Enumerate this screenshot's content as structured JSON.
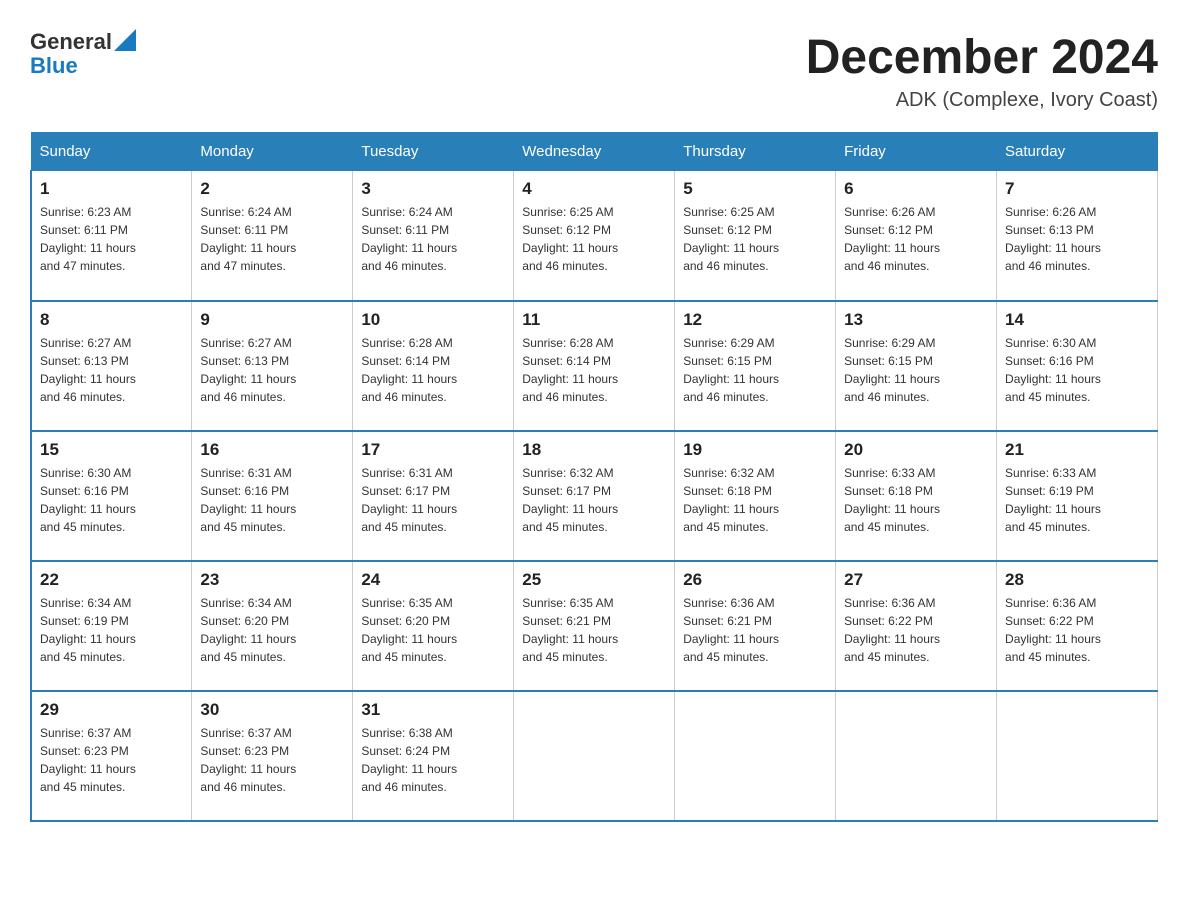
{
  "header": {
    "logo_text_general": "General",
    "logo_text_blue": "Blue",
    "month_title": "December 2024",
    "location": "ADK (Complexe, Ivory Coast)"
  },
  "days_of_week": [
    "Sunday",
    "Monday",
    "Tuesday",
    "Wednesday",
    "Thursday",
    "Friday",
    "Saturday"
  ],
  "weeks": [
    [
      {
        "day": "1",
        "sunrise": "6:23 AM",
        "sunset": "6:11 PM",
        "daylight": "11 hours and 47 minutes."
      },
      {
        "day": "2",
        "sunrise": "6:24 AM",
        "sunset": "6:11 PM",
        "daylight": "11 hours and 47 minutes."
      },
      {
        "day": "3",
        "sunrise": "6:24 AM",
        "sunset": "6:11 PM",
        "daylight": "11 hours and 46 minutes."
      },
      {
        "day": "4",
        "sunrise": "6:25 AM",
        "sunset": "6:12 PM",
        "daylight": "11 hours and 46 minutes."
      },
      {
        "day": "5",
        "sunrise": "6:25 AM",
        "sunset": "6:12 PM",
        "daylight": "11 hours and 46 minutes."
      },
      {
        "day": "6",
        "sunrise": "6:26 AM",
        "sunset": "6:12 PM",
        "daylight": "11 hours and 46 minutes."
      },
      {
        "day": "7",
        "sunrise": "6:26 AM",
        "sunset": "6:13 PM",
        "daylight": "11 hours and 46 minutes."
      }
    ],
    [
      {
        "day": "8",
        "sunrise": "6:27 AM",
        "sunset": "6:13 PM",
        "daylight": "11 hours and 46 minutes."
      },
      {
        "day": "9",
        "sunrise": "6:27 AM",
        "sunset": "6:13 PM",
        "daylight": "11 hours and 46 minutes."
      },
      {
        "day": "10",
        "sunrise": "6:28 AM",
        "sunset": "6:14 PM",
        "daylight": "11 hours and 46 minutes."
      },
      {
        "day": "11",
        "sunrise": "6:28 AM",
        "sunset": "6:14 PM",
        "daylight": "11 hours and 46 minutes."
      },
      {
        "day": "12",
        "sunrise": "6:29 AM",
        "sunset": "6:15 PM",
        "daylight": "11 hours and 46 minutes."
      },
      {
        "day": "13",
        "sunrise": "6:29 AM",
        "sunset": "6:15 PM",
        "daylight": "11 hours and 46 minutes."
      },
      {
        "day": "14",
        "sunrise": "6:30 AM",
        "sunset": "6:16 PM",
        "daylight": "11 hours and 45 minutes."
      }
    ],
    [
      {
        "day": "15",
        "sunrise": "6:30 AM",
        "sunset": "6:16 PM",
        "daylight": "11 hours and 45 minutes."
      },
      {
        "day": "16",
        "sunrise": "6:31 AM",
        "sunset": "6:16 PM",
        "daylight": "11 hours and 45 minutes."
      },
      {
        "day": "17",
        "sunrise": "6:31 AM",
        "sunset": "6:17 PM",
        "daylight": "11 hours and 45 minutes."
      },
      {
        "day": "18",
        "sunrise": "6:32 AM",
        "sunset": "6:17 PM",
        "daylight": "11 hours and 45 minutes."
      },
      {
        "day": "19",
        "sunrise": "6:32 AM",
        "sunset": "6:18 PM",
        "daylight": "11 hours and 45 minutes."
      },
      {
        "day": "20",
        "sunrise": "6:33 AM",
        "sunset": "6:18 PM",
        "daylight": "11 hours and 45 minutes."
      },
      {
        "day": "21",
        "sunrise": "6:33 AM",
        "sunset": "6:19 PM",
        "daylight": "11 hours and 45 minutes."
      }
    ],
    [
      {
        "day": "22",
        "sunrise": "6:34 AM",
        "sunset": "6:19 PM",
        "daylight": "11 hours and 45 minutes."
      },
      {
        "day": "23",
        "sunrise": "6:34 AM",
        "sunset": "6:20 PM",
        "daylight": "11 hours and 45 minutes."
      },
      {
        "day": "24",
        "sunrise": "6:35 AM",
        "sunset": "6:20 PM",
        "daylight": "11 hours and 45 minutes."
      },
      {
        "day": "25",
        "sunrise": "6:35 AM",
        "sunset": "6:21 PM",
        "daylight": "11 hours and 45 minutes."
      },
      {
        "day": "26",
        "sunrise": "6:36 AM",
        "sunset": "6:21 PM",
        "daylight": "11 hours and 45 minutes."
      },
      {
        "day": "27",
        "sunrise": "6:36 AM",
        "sunset": "6:22 PM",
        "daylight": "11 hours and 45 minutes."
      },
      {
        "day": "28",
        "sunrise": "6:36 AM",
        "sunset": "6:22 PM",
        "daylight": "11 hours and 45 minutes."
      }
    ],
    [
      {
        "day": "29",
        "sunrise": "6:37 AM",
        "sunset": "6:23 PM",
        "daylight": "11 hours and 45 minutes."
      },
      {
        "day": "30",
        "sunrise": "6:37 AM",
        "sunset": "6:23 PM",
        "daylight": "11 hours and 46 minutes."
      },
      {
        "day": "31",
        "sunrise": "6:38 AM",
        "sunset": "6:24 PM",
        "daylight": "11 hours and 46 minutes."
      },
      null,
      null,
      null,
      null
    ]
  ]
}
